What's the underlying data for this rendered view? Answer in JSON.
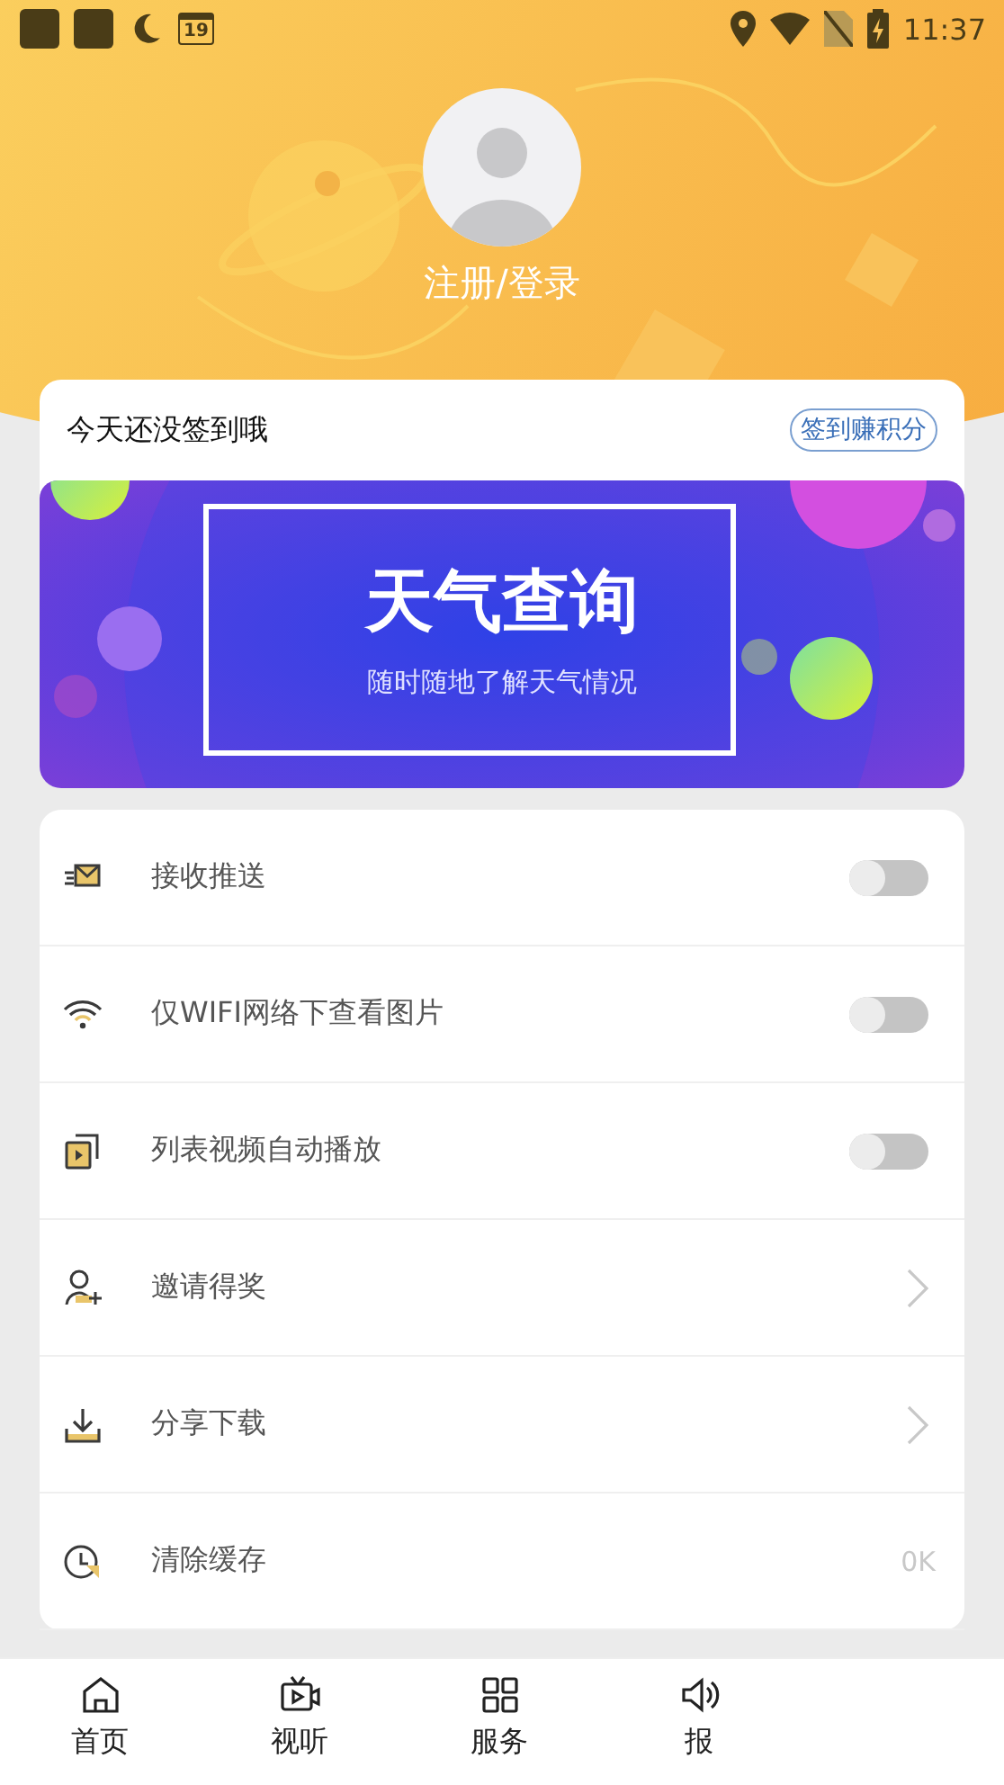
{
  "status_bar": {
    "time": "11:37",
    "calendar_day": "19"
  },
  "profile": {
    "login_label": "注册/登录"
  },
  "sign_in": {
    "message": "今天还没签到哦",
    "button": "签到赚积分"
  },
  "banner": {
    "title": "天气查询",
    "subtitle": "随时随地了解天气情况"
  },
  "settings": [
    {
      "kind": "toggle",
      "label": "接收推送",
      "on": false
    },
    {
      "kind": "toggle",
      "label": "仅WIFI网络下查看图片",
      "on": false
    },
    {
      "kind": "toggle",
      "label": "列表视频自动播放",
      "on": false
    },
    {
      "kind": "link",
      "label": "邀请得奖"
    },
    {
      "kind": "link",
      "label": "分享下载"
    },
    {
      "kind": "value",
      "label": "清除缓存",
      "value": "0K"
    }
  ],
  "tabs": [
    {
      "label": "首页"
    },
    {
      "label": "视听"
    },
    {
      "label": "服务"
    },
    {
      "label": "报"
    }
  ]
}
